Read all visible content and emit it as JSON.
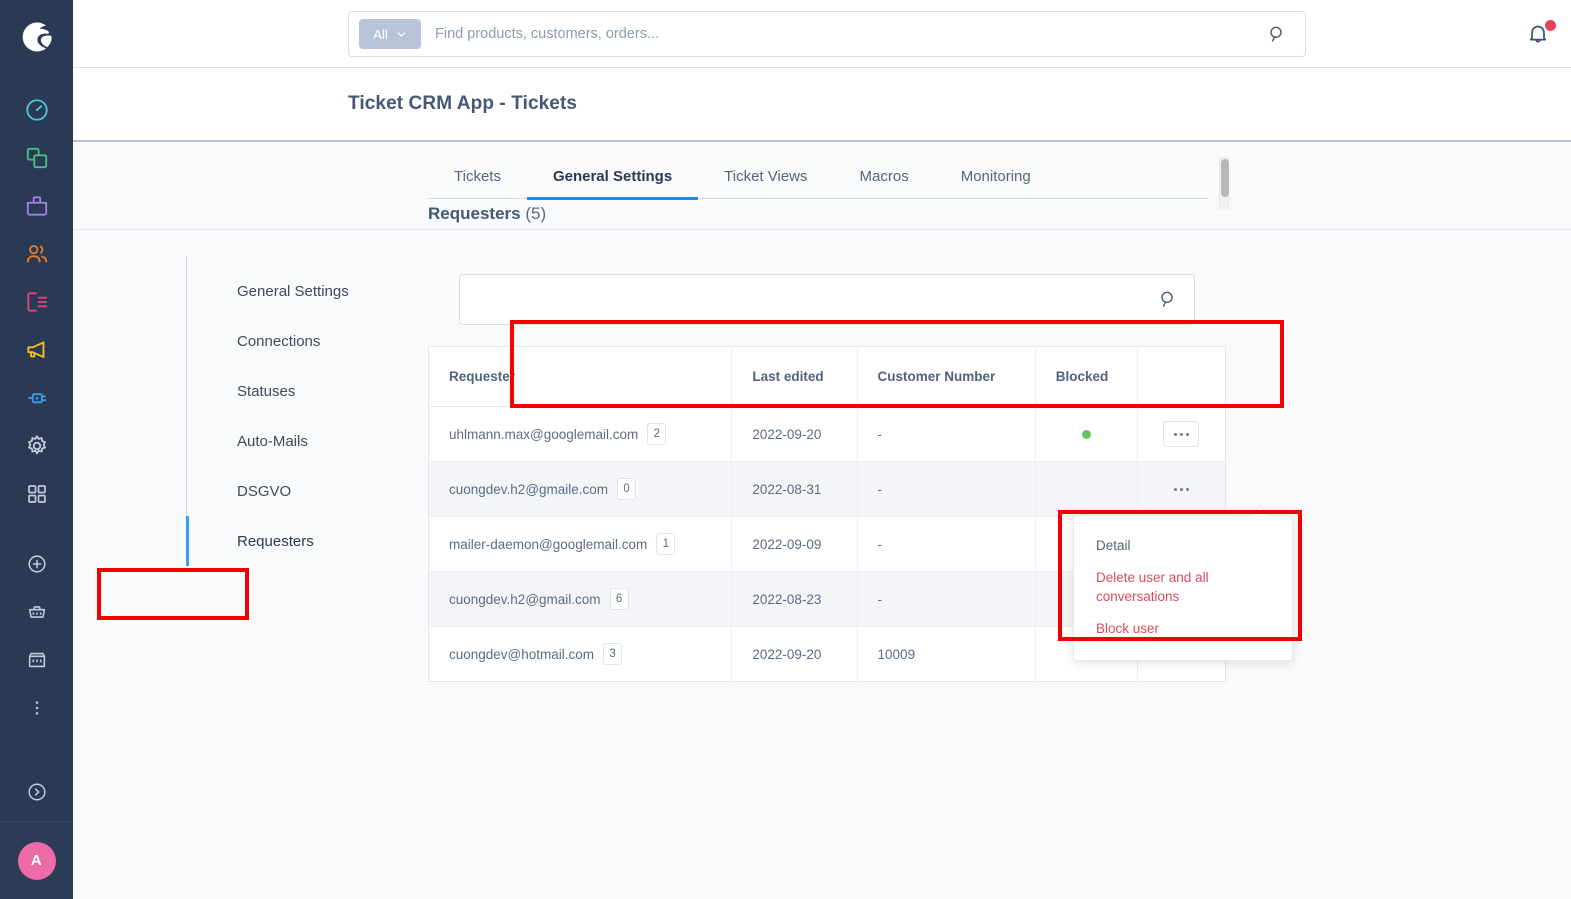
{
  "sidebar": {
    "logo": "shopware-logo",
    "items": [
      {
        "name": "dashboard",
        "icon": "gauge-icon",
        "color": "#4dc5d8"
      },
      {
        "name": "catalogues",
        "icon": "layers-icon",
        "color": "#4bbd86"
      },
      {
        "name": "orders",
        "icon": "briefcase-icon",
        "color": "#a183e8"
      },
      {
        "name": "customers",
        "icon": "users-icon",
        "color": "#e9792f"
      },
      {
        "name": "content",
        "icon": "content-list-icon",
        "color": "#e3437f"
      },
      {
        "name": "marketing",
        "icon": "megaphone-icon",
        "color": "#f2c31c"
      },
      {
        "name": "extensions",
        "icon": "plug-icon",
        "color": "#3c9ff0"
      },
      {
        "name": "settings",
        "icon": "gear-icon",
        "color": "#c2cada"
      },
      {
        "name": "apps",
        "icon": "grid-icon",
        "color": "#c2cada"
      }
    ],
    "secondary": [
      {
        "name": "add",
        "icon": "plus-circle-icon",
        "color": "#c2cada"
      },
      {
        "name": "storefront-basket",
        "icon": "basket-icon",
        "color": "#c2cada"
      },
      {
        "name": "shop",
        "icon": "store-icon",
        "color": "#c2cada"
      },
      {
        "name": "more",
        "icon": "more-vertical-icon",
        "color": "#c2cada"
      }
    ],
    "expand": {
      "name": "expand",
      "icon": "chevron-right-circle-icon",
      "color": "#c2cada"
    },
    "avatar_initial": "A",
    "avatar_color": "#ed6ba7"
  },
  "topbar": {
    "search": {
      "scope_label": "All",
      "placeholder": "Find products, customers, orders...",
      "value": ""
    },
    "notifications_icon": "bell-icon",
    "has_notification": true
  },
  "header": {
    "title": "Ticket CRM App - Tickets"
  },
  "tabs": {
    "items": [
      {
        "label": "Tickets",
        "active": false
      },
      {
        "label": "General Settings",
        "active": true
      },
      {
        "label": "Ticket Views",
        "active": false
      },
      {
        "label": "Macros",
        "active": false
      },
      {
        "label": "Monitoring",
        "active": false
      }
    ],
    "active_color": "#1f8ced"
  },
  "subheader": {
    "title": "Requesters",
    "count": "(5)"
  },
  "leftnav": {
    "items": [
      {
        "label": "General Settings",
        "active": false
      },
      {
        "label": "Connections",
        "active": false
      },
      {
        "label": "Statuses",
        "active": false
      },
      {
        "label": "Auto-Mails",
        "active": false
      },
      {
        "label": "DSGVO",
        "active": false
      },
      {
        "label": "Requesters",
        "active": true
      }
    ]
  },
  "requester_search": {
    "value": "",
    "placeholder": "",
    "icon": "search-icon"
  },
  "table": {
    "columns": [
      "Requester",
      "Last edited",
      "Customer Number",
      "Blocked",
      ""
    ],
    "rows": [
      {
        "requester": "uhlmann.max@googlemail.com",
        "count": "2",
        "last_edited": "2022-09-20",
        "customer_number": "-",
        "blocked": true,
        "menu_open": true
      },
      {
        "requester": "cuongdev.h2@gmaile.com",
        "count": "0",
        "last_edited": "2022-08-31",
        "customer_number": "-",
        "blocked": false,
        "menu_open": false
      },
      {
        "requester": "mailer-daemon@googlemail.com",
        "count": "1",
        "last_edited": "2022-09-09",
        "customer_number": "-",
        "blocked": false,
        "menu_open": false
      },
      {
        "requester": "cuongdev.h2@gmail.com",
        "count": "6",
        "last_edited": "2022-08-23",
        "customer_number": "-",
        "blocked": false,
        "menu_open": false
      },
      {
        "requester": "cuongdev@hotmail.com",
        "count": "3",
        "last_edited": "2022-09-20",
        "customer_number": "10009",
        "blocked": true,
        "menu_open": false
      }
    ]
  },
  "context_menu": {
    "items": [
      {
        "label": "Detail",
        "danger": false
      },
      {
        "label": "Delete user and all conversations",
        "danger": true
      },
      {
        "label": "Block user",
        "danger": true
      }
    ],
    "danger_color": "#df4b5d"
  },
  "annotations": {
    "color": "#f40000",
    "boxes": [
      "requesters-nav-item",
      "requester-search-field",
      "row-context-menu"
    ]
  }
}
